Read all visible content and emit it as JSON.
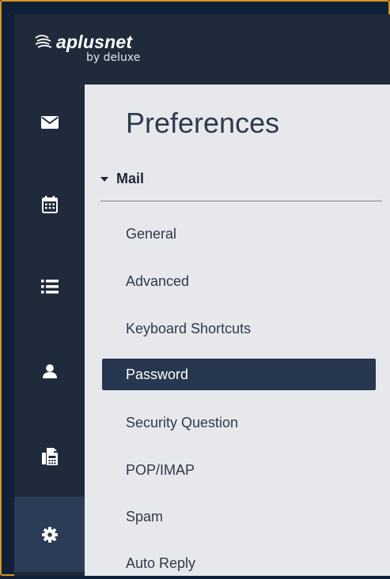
{
  "brand": {
    "name": "aplusnet",
    "sub": "by deluxe"
  },
  "rail": [
    {
      "name": "mail",
      "icon": "envelope-icon"
    },
    {
      "name": "calendar",
      "icon": "calendar-icon"
    },
    {
      "name": "tasks",
      "icon": "list-icon"
    },
    {
      "name": "contacts",
      "icon": "person-icon"
    },
    {
      "name": "fax",
      "icon": "fax-icon"
    },
    {
      "name": "settings",
      "icon": "gear-icon",
      "active": true
    }
  ],
  "page": {
    "title": "Preferences"
  },
  "section": {
    "label": "Mail",
    "expanded": true
  },
  "nav": [
    {
      "label": "General"
    },
    {
      "label": "Advanced"
    },
    {
      "label": "Keyboard Shortcuts"
    },
    {
      "label": "Password",
      "active": true
    },
    {
      "label": "Security Question"
    },
    {
      "label": "POP/IMAP"
    },
    {
      "label": "Spam"
    },
    {
      "label": "Auto Reply"
    }
  ],
  "colors": {
    "accent_border": "#d4951e",
    "rail_bg": "#1f2b3b",
    "active_nav": "#26374f",
    "content_bg": "#e6e8eb"
  }
}
